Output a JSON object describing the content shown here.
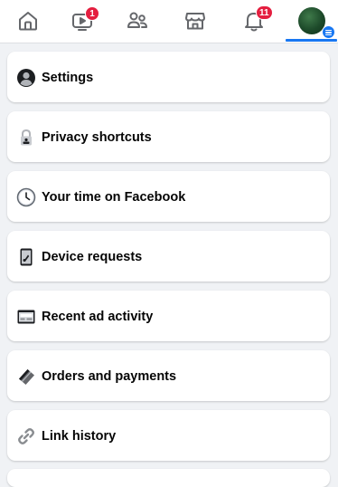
{
  "nav": {
    "tabs": [
      {
        "name": "home",
        "icon": "home-icon",
        "active": false
      },
      {
        "name": "watch",
        "icon": "video-icon",
        "badge": "1",
        "active": false
      },
      {
        "name": "friends",
        "icon": "friends-icon",
        "active": false
      },
      {
        "name": "marketplace",
        "icon": "marketplace-icon",
        "active": false
      },
      {
        "name": "notifications",
        "icon": "bell-icon",
        "badge": "11",
        "active": false
      },
      {
        "name": "menu",
        "icon": "avatar",
        "active": true
      }
    ],
    "accent_color": "#1877f2",
    "badge_color": "#e41e3f"
  },
  "menu_items": [
    {
      "label": "Settings",
      "icon": "user-circle-icon"
    },
    {
      "label": "Privacy shortcuts",
      "icon": "lock-icon"
    },
    {
      "label": "Your time on Facebook",
      "icon": "clock-icon"
    },
    {
      "label": "Device requests",
      "icon": "phone-icon"
    },
    {
      "label": "Recent ad activity",
      "icon": "ad-icon"
    },
    {
      "label": "Orders and payments",
      "icon": "card-icon"
    },
    {
      "label": "Link history",
      "icon": "link-icon"
    }
  ]
}
